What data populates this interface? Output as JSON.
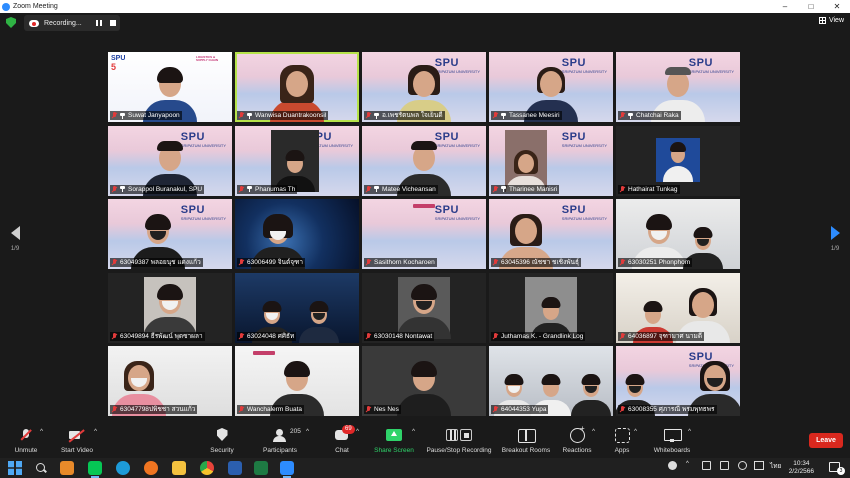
{
  "window": {
    "title": "Zoom Meeting",
    "controls": [
      "minimize-icon",
      "maximize-icon",
      "close-icon"
    ]
  },
  "topbar": {
    "recording_label": "Recording...",
    "view_label": "View"
  },
  "pager": {
    "left": "1/9",
    "right": "1/9",
    "accent": "#2d8cff"
  },
  "tiles": [
    {
      "name": "Suwat Janyapoon",
      "pinned": true
    },
    {
      "name": "Wanwisa Duantrakoonsil",
      "pinned": true,
      "active": true
    },
    {
      "name": "อ.เพชรัตนพล ใจเย็นดี",
      "pinned": true
    },
    {
      "name": "Tassanee Meesiri",
      "pinned": true
    },
    {
      "name": "Chatchai Raka",
      "pinned": true
    },
    {
      "name": "Sorappol Buranakul, SPU",
      "pinned": true
    },
    {
      "name": "Phanumas Th",
      "pinned": true
    },
    {
      "name": "Matee Vicheansan",
      "pinned": true
    },
    {
      "name": "Tharinee Manisri",
      "pinned": true
    },
    {
      "name": "Hathairat Tunkag",
      "pinned": false
    },
    {
      "name": "63049387 พลอยนุช แดงแก้ว",
      "pinned": false
    },
    {
      "name": "63006499 จินต์จุฑา",
      "pinned": false
    },
    {
      "name": "Sasithorn Kocharoen",
      "pinned": false
    },
    {
      "name": "63045396 ณัชชา ชเชิงพันธุ์",
      "pinned": false
    },
    {
      "name": "63030251 Phonphom",
      "pinned": false
    },
    {
      "name": "63049894 ธีรพัฒน์ พุดซาผลา",
      "pinned": false
    },
    {
      "name": "63024048 ศศิธัท",
      "pinned": false
    },
    {
      "name": "63030148 Nontawat",
      "pinned": false
    },
    {
      "name": "Juthamas K. - Grandlink Log",
      "pinned": false
    },
    {
      "name": "64036897 จุฑามาศ นามดี",
      "pinned": false
    },
    {
      "name": "63047798ปพิชชา สวนแก้ว",
      "pinned": false
    },
    {
      "name": "Wanchalerm Buata",
      "pinned": false
    },
    {
      "name": "Nes Nes",
      "pinned": false
    },
    {
      "name": "64044353 Yupa",
      "pinned": false
    },
    {
      "name": "63008355 ศุภารณี พรมพุทธพร",
      "pinned": false
    }
  ],
  "toolbar": {
    "unmute": "Unmute",
    "start_video": "Start Video",
    "security": "Security",
    "participants": "Participants",
    "participants_count": "205",
    "chat": "Chat",
    "chat_badge": "69",
    "share_screen": "Share Screen",
    "recording": "Pause/Stop Recording",
    "breakout": "Breakout Rooms",
    "reactions": "Reactions",
    "apps": "Apps",
    "whiteboards": "Whiteboards",
    "leave": "Leave"
  },
  "taskbar": {
    "apps": [
      "windows-start-icon",
      "search-icon",
      "media-player-icon",
      "line-icon",
      "edge-icon",
      "firefox-icon",
      "file-explorer-icon",
      "chrome-icon",
      "word-icon",
      "excel-icon",
      "zoom-icon"
    ],
    "language": "ไทย",
    "time": "10:34",
    "date": "2/2/2566",
    "notification_count": "3"
  },
  "colors": {
    "leave": "#d9281e",
    "share": "#2fd36a",
    "active_speaker": "#b6e34a",
    "muted": "#e23b3b"
  }
}
